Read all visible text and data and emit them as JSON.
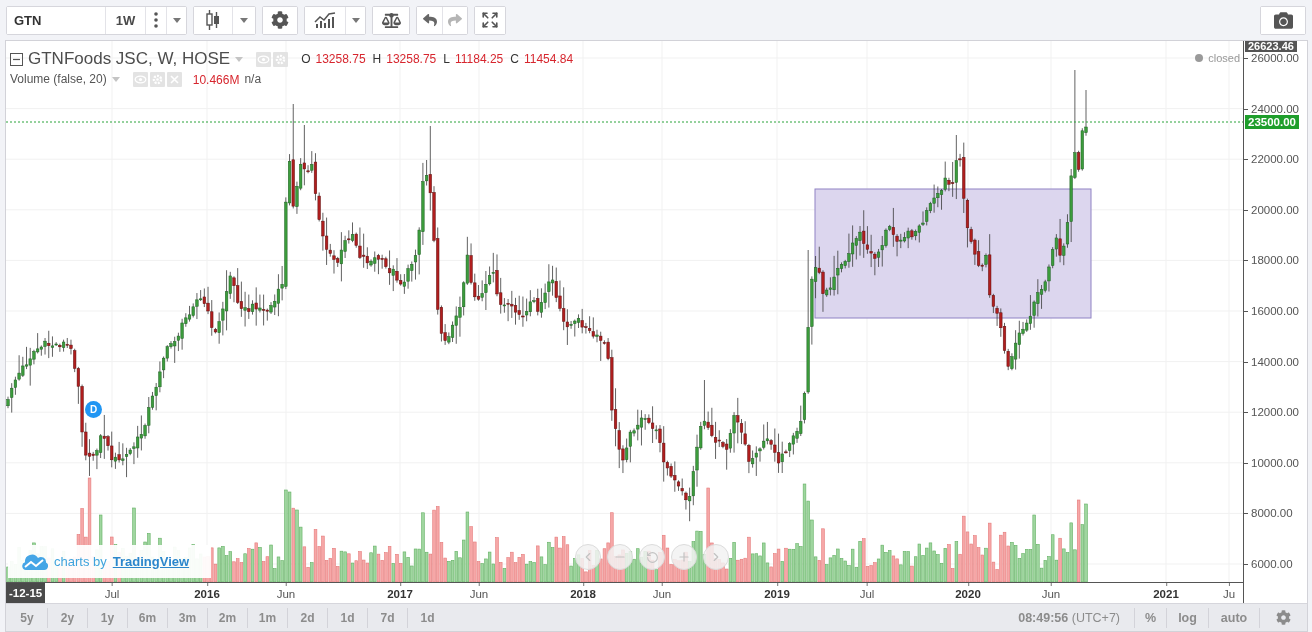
{
  "toolbar": {
    "symbol": "GTN",
    "interval": "1W"
  },
  "legend": {
    "title": "GTNFoods JSC, W, HOSE",
    "ohlc": [
      {
        "label": "O",
        "value": "13258.75"
      },
      {
        "label": "H",
        "value": "13258.75"
      },
      {
        "label": "L",
        "value": "11184.25"
      },
      {
        "label": "C",
        "value": "11454.84"
      }
    ],
    "indicator": {
      "name": "Volume (false, 20)",
      "value": "10.466M",
      "note": "n/a"
    }
  },
  "market_status": "closed",
  "chart": {
    "marker": "D"
  },
  "price_axis": {
    "high_label": "26623.46",
    "labels": [
      "26000.00",
      "24000.00",
      "22000.00",
      "20000.00",
      "18000.00",
      "16000.00",
      "14000.00",
      "12000.00",
      "10000.00",
      "8000.00",
      "6000.00"
    ],
    "last_price": "23500.00"
  },
  "time_axis": {
    "cursor_label": "-12-15",
    "labels": [
      {
        "text": "Jul",
        "major": false
      },
      {
        "text": "2016",
        "major": true
      },
      {
        "text": "Jun",
        "major": false
      },
      {
        "text": "2017",
        "major": true
      },
      {
        "text": "Jun",
        "major": false
      },
      {
        "text": "2018",
        "major": true
      },
      {
        "text": "Jun",
        "major": false
      },
      {
        "text": "2019",
        "major": true
      },
      {
        "text": "Jul",
        "major": false
      },
      {
        "text": "2020",
        "major": true
      },
      {
        "text": "Jun",
        "major": false
      },
      {
        "text": "2021",
        "major": true
      },
      {
        "text": "Ju",
        "major": false
      }
    ]
  },
  "branding": {
    "prefix": "charts by",
    "link": "TradingView"
  },
  "range_buttons": [
    "5y",
    "2y",
    "1y",
    "6m",
    "3m",
    "2m",
    "1m",
    "2d",
    "1d",
    "7d",
    "1d"
  ],
  "footer": {
    "clock": "**08:49:56** (UTC+7)",
    "scale_options": [
      "%",
      "log",
      "auto"
    ]
  }
}
